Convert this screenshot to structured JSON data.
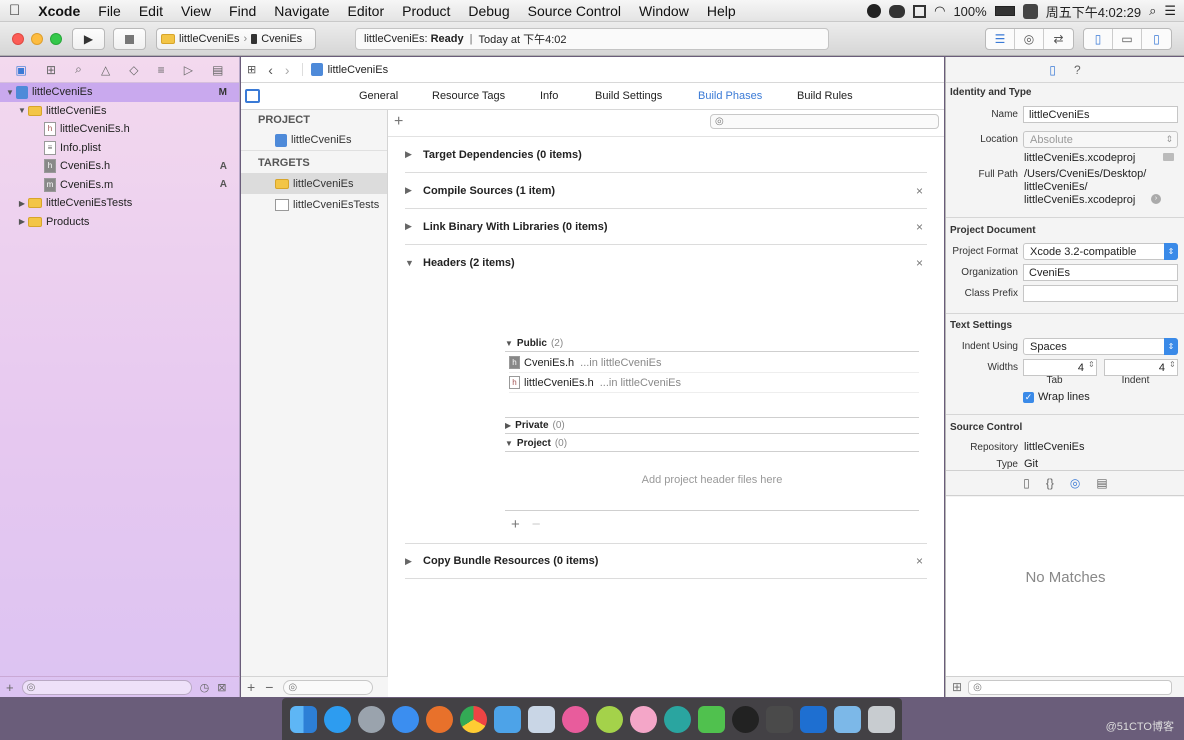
{
  "menubar": {
    "apple": "",
    "items": [
      "Xcode",
      "File",
      "Edit",
      "View",
      "Find",
      "Navigate",
      "Editor",
      "Product",
      "Debug",
      "Source Control",
      "Window",
      "Help"
    ],
    "battery": "100%",
    "clock": "周五下午4:02:29"
  },
  "toolbar": {
    "scheme": "littleCveniEs",
    "device": "CveniEs",
    "activity_project": "littleCveniEs:",
    "activity_status": "Ready",
    "activity_sep": "|",
    "activity_time": "Today at 下午4:02"
  },
  "navigator": {
    "tree": [
      {
        "label": "littleCveniEs",
        "badge": "M"
      },
      {
        "label": "littleCveniEs",
        "badge": ""
      },
      {
        "label": "littleCveniEs.h",
        "badge": ""
      },
      {
        "label": "Info.plist",
        "badge": ""
      },
      {
        "label": "CveniEs.h",
        "badge": "A"
      },
      {
        "label": "CveniEs.m",
        "badge": "A"
      },
      {
        "label": "littleCveniEsTests",
        "badge": ""
      },
      {
        "label": "Products",
        "badge": ""
      }
    ]
  },
  "editor": {
    "breadcrumb": "littleCveniEs",
    "tabs": [
      "General",
      "Resource Tags",
      "Info",
      "Build Settings",
      "Build Phases",
      "Build Rules"
    ],
    "project_header": "PROJECT",
    "project_item": "littleCveniEs",
    "targets_header": "TARGETS",
    "targets": [
      "littleCveniEs",
      "littleCveniEsTests"
    ],
    "phases": {
      "target_dependencies": "Target Dependencies (0 items)",
      "compile_sources": "Compile Sources (1 item)",
      "link_binary": "Link Binary With Libraries (0 items)",
      "headers": "Headers (2 items)",
      "copy_bundle": "Copy Bundle Resources (0 items)"
    },
    "headers_public": {
      "label": "Public",
      "count": "(2)"
    },
    "header_files": [
      {
        "name": "CveniEs.h",
        "location": "...in littleCveniEs"
      },
      {
        "name": "littleCveniEs.h",
        "location": "...in littleCveniEs"
      }
    ],
    "headers_private": {
      "label": "Private",
      "count": "(0)"
    },
    "headers_project": {
      "label": "Project",
      "count": "(0)"
    },
    "drop_hint": "Add project header files here"
  },
  "inspector": {
    "identity_header": "Identity and Type",
    "name_label": "Name",
    "name_value": "littleCveniEs",
    "location_label": "Location",
    "location_value": "Absolute",
    "file_name": "littleCveniEs.xcodeproj",
    "full_path_label": "Full Path",
    "full_path_lines": [
      "/Users/CveniEs/Desktop/",
      "littleCveniEs/",
      "littleCveniEs.xcodeproj"
    ],
    "project_doc_header": "Project Document",
    "project_format_label": "Project Format",
    "project_format_value": "Xcode 3.2-compatible",
    "organization_label": "Organization",
    "organization_value": "CveniEs",
    "class_prefix_label": "Class Prefix",
    "class_prefix_value": "",
    "text_settings_header": "Text Settings",
    "indent_using_label": "Indent Using",
    "indent_using_value": "Spaces",
    "widths_label": "Widths",
    "tab_value": "4",
    "indent_value": "4",
    "tab_caption": "Tab",
    "indent_caption": "Indent",
    "wrap_lines_label": "Wrap lines",
    "source_control_header": "Source Control",
    "repository_label": "Repository",
    "repository_value": "littleCveniEs",
    "type_label": "Type",
    "type_value": "Git",
    "no_matches": "No Matches"
  },
  "watermark": "@51CTO博客"
}
